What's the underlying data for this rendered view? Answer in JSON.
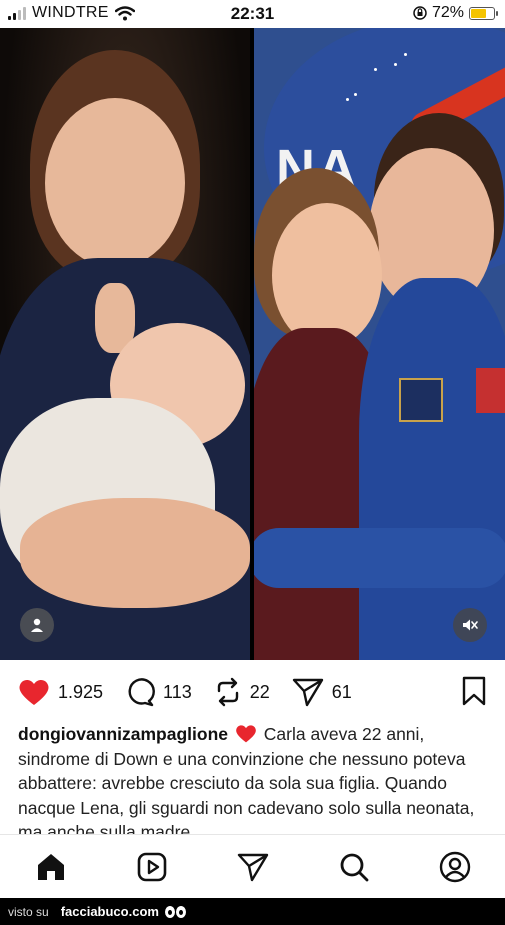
{
  "status_bar": {
    "carrier": "WINDTRE",
    "time": "22:31",
    "battery_percent": "72%",
    "battery_level": 0.72,
    "battery_color": "#f5c400",
    "icons": [
      "signal-icon",
      "wifi-icon",
      "orientation-lock-icon",
      "battery-icon"
    ]
  },
  "post": {
    "image_description_icons": [
      "person-tag-icon",
      "mute-icon"
    ],
    "nasa_logo_text": "NA",
    "actions": {
      "likes": "1.925",
      "comments": "113",
      "reposts": "22",
      "shares": "61"
    },
    "caption": {
      "username": "dongiovannizampaglione",
      "text": "Carla aveva 22 anni, sindrome di Down e una convinzione che nessuno poteva abbattere: avrebbe cresciuto da sola sua figlia. Quando nacque Lena, gli sguardi non cadevano solo sulla neonata, ma anche sulla madre."
    }
  },
  "bottom_nav": [
    "home-icon",
    "reels-icon",
    "send-icon",
    "search-icon",
    "profile-icon"
  ],
  "footer": {
    "visto_su": "visto su",
    "site": "facciabuco.com"
  },
  "colors": {
    "like_red": "#e8262e",
    "nasa_blue": "#2c4e9d",
    "nasa_red": "#d8341f"
  }
}
